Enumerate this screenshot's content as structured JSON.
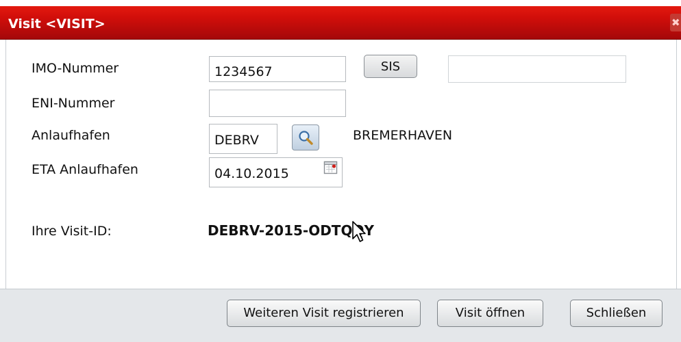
{
  "dialog": {
    "title": "Visit <VISIT>",
    "close_glyph": "✖"
  },
  "form": {
    "imo": {
      "label": "IMO-Nummer",
      "value": "1234567"
    },
    "sis_button": "SIS",
    "sis_result": "",
    "eni": {
      "label": "ENI-Nummer",
      "value": ""
    },
    "port": {
      "label": "Anlaufhafen",
      "value": "DEBRV",
      "name": "BREMERHAVEN"
    },
    "eta": {
      "label": "ETA Anlaufhafen",
      "value": "04.10.2015"
    },
    "visit_id": {
      "label": "Ihre Visit-ID:",
      "value": "DEBRV-2015-ODTQQY"
    }
  },
  "footer": {
    "register_another": "Weiteren Visit registrieren",
    "open_visit": "Visit öffnen",
    "close": "Schließen"
  },
  "icons": {
    "search": "magnifier-icon",
    "calendar": "calendar-icon",
    "close": "close-icon",
    "cursor": "mouse-pointer-icon"
  }
}
